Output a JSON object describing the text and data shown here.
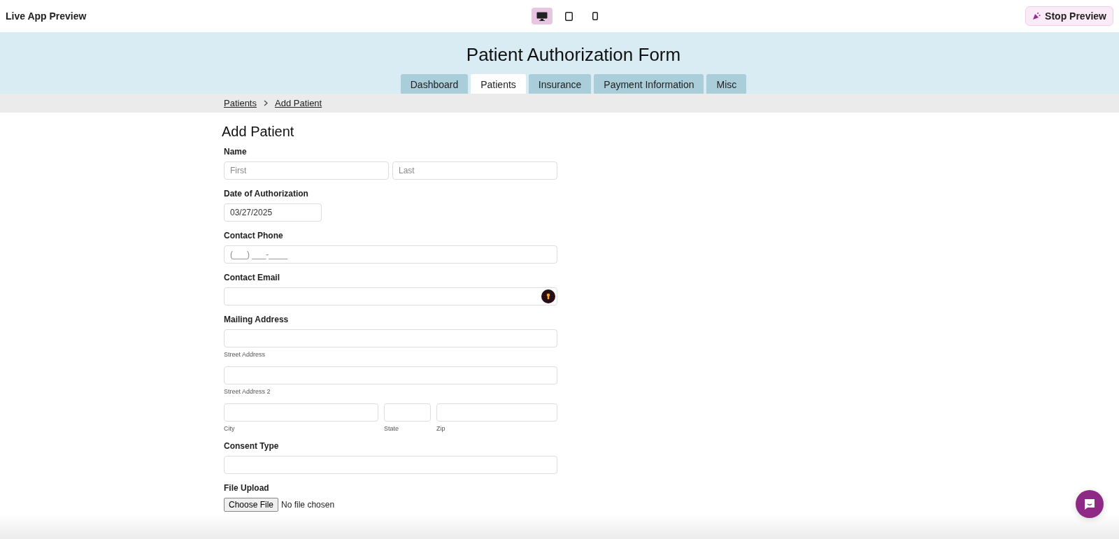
{
  "topbar": {
    "title": "Live App Preview",
    "devices": [
      {
        "kind": "desktop",
        "selected": true
      },
      {
        "kind": "tablet",
        "selected": false
      },
      {
        "kind": "phone",
        "selected": false
      }
    ],
    "stop_button": "Stop Preview"
  },
  "header": {
    "title": "Patient Authorization Form",
    "tabs": [
      {
        "label": "Dashboard",
        "selected": false
      },
      {
        "label": "Patients",
        "selected": true
      },
      {
        "label": "Insurance",
        "selected": false
      },
      {
        "label": "Payment Information",
        "selected": false
      },
      {
        "label": "Misc",
        "selected": false
      }
    ]
  },
  "breadcrumb": [
    "Patients",
    "Add Patient"
  ],
  "form": {
    "title": "Add Patient",
    "fields": [
      {
        "kind": "name",
        "label": "Name",
        "first_placeholder": "First",
        "last_placeholder": "Last"
      },
      {
        "kind": "date",
        "label": "Date of Authorization",
        "value": "03/27/2025"
      },
      {
        "kind": "text",
        "label": "Contact Phone",
        "placeholder": "(___) ___-____"
      },
      {
        "kind": "email",
        "label": "Contact Email"
      },
      {
        "kind": "address",
        "label": "Mailing Address",
        "street_caption": "Street Address",
        "street2_caption": "Street Address 2",
        "city_caption": "City",
        "state_caption": "State",
        "zip_caption": "Zip"
      },
      {
        "kind": "text",
        "label": "Consent Type"
      },
      {
        "kind": "file",
        "label": "File Upload",
        "button": "Choose File",
        "status": "No file chosen"
      }
    ]
  }
}
